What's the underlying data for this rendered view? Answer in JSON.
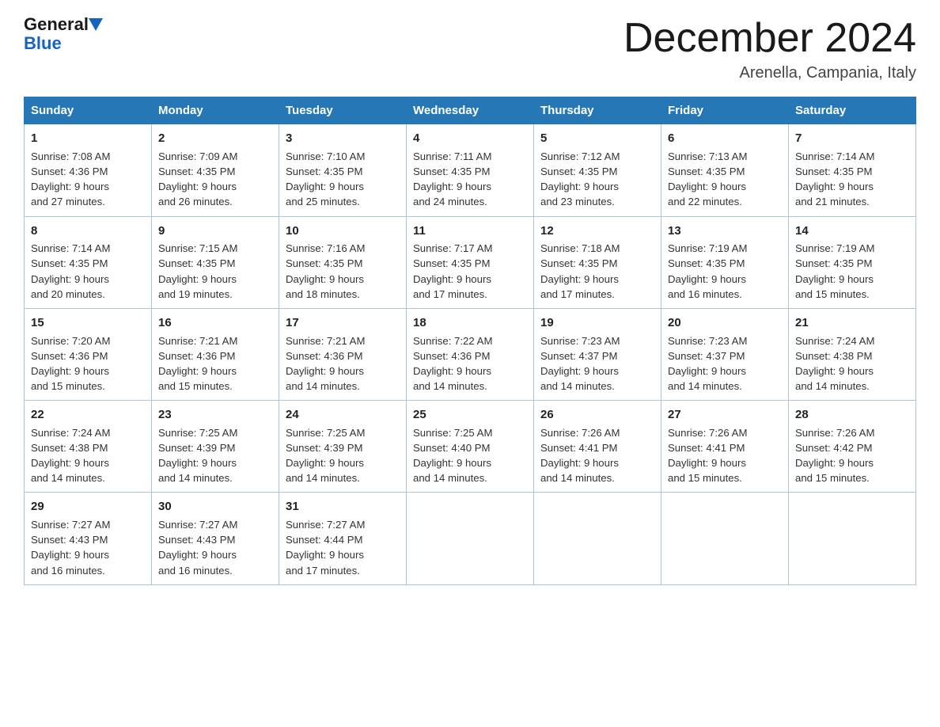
{
  "header": {
    "logo_general": "General",
    "logo_blue": "Blue",
    "month_title": "December 2024",
    "location": "Arenella, Campania, Italy"
  },
  "days_of_week": [
    "Sunday",
    "Monday",
    "Tuesday",
    "Wednesday",
    "Thursday",
    "Friday",
    "Saturday"
  ],
  "weeks": [
    [
      {
        "day": "1",
        "sunrise": "7:08 AM",
        "sunset": "4:36 PM",
        "daylight": "9 hours and 27 minutes."
      },
      {
        "day": "2",
        "sunrise": "7:09 AM",
        "sunset": "4:35 PM",
        "daylight": "9 hours and 26 minutes."
      },
      {
        "day": "3",
        "sunrise": "7:10 AM",
        "sunset": "4:35 PM",
        "daylight": "9 hours and 25 minutes."
      },
      {
        "day": "4",
        "sunrise": "7:11 AM",
        "sunset": "4:35 PM",
        "daylight": "9 hours and 24 minutes."
      },
      {
        "day": "5",
        "sunrise": "7:12 AM",
        "sunset": "4:35 PM",
        "daylight": "9 hours and 23 minutes."
      },
      {
        "day": "6",
        "sunrise": "7:13 AM",
        "sunset": "4:35 PM",
        "daylight": "9 hours and 22 minutes."
      },
      {
        "day": "7",
        "sunrise": "7:14 AM",
        "sunset": "4:35 PM",
        "daylight": "9 hours and 21 minutes."
      }
    ],
    [
      {
        "day": "8",
        "sunrise": "7:14 AM",
        "sunset": "4:35 PM",
        "daylight": "9 hours and 20 minutes."
      },
      {
        "day": "9",
        "sunrise": "7:15 AM",
        "sunset": "4:35 PM",
        "daylight": "9 hours and 19 minutes."
      },
      {
        "day": "10",
        "sunrise": "7:16 AM",
        "sunset": "4:35 PM",
        "daylight": "9 hours and 18 minutes."
      },
      {
        "day": "11",
        "sunrise": "7:17 AM",
        "sunset": "4:35 PM",
        "daylight": "9 hours and 17 minutes."
      },
      {
        "day": "12",
        "sunrise": "7:18 AM",
        "sunset": "4:35 PM",
        "daylight": "9 hours and 17 minutes."
      },
      {
        "day": "13",
        "sunrise": "7:19 AM",
        "sunset": "4:35 PM",
        "daylight": "9 hours and 16 minutes."
      },
      {
        "day": "14",
        "sunrise": "7:19 AM",
        "sunset": "4:35 PM",
        "daylight": "9 hours and 15 minutes."
      }
    ],
    [
      {
        "day": "15",
        "sunrise": "7:20 AM",
        "sunset": "4:36 PM",
        "daylight": "9 hours and 15 minutes."
      },
      {
        "day": "16",
        "sunrise": "7:21 AM",
        "sunset": "4:36 PM",
        "daylight": "9 hours and 15 minutes."
      },
      {
        "day": "17",
        "sunrise": "7:21 AM",
        "sunset": "4:36 PM",
        "daylight": "9 hours and 14 minutes."
      },
      {
        "day": "18",
        "sunrise": "7:22 AM",
        "sunset": "4:36 PM",
        "daylight": "9 hours and 14 minutes."
      },
      {
        "day": "19",
        "sunrise": "7:23 AM",
        "sunset": "4:37 PM",
        "daylight": "9 hours and 14 minutes."
      },
      {
        "day": "20",
        "sunrise": "7:23 AM",
        "sunset": "4:37 PM",
        "daylight": "9 hours and 14 minutes."
      },
      {
        "day": "21",
        "sunrise": "7:24 AM",
        "sunset": "4:38 PM",
        "daylight": "9 hours and 14 minutes."
      }
    ],
    [
      {
        "day": "22",
        "sunrise": "7:24 AM",
        "sunset": "4:38 PM",
        "daylight": "9 hours and 14 minutes."
      },
      {
        "day": "23",
        "sunrise": "7:25 AM",
        "sunset": "4:39 PM",
        "daylight": "9 hours and 14 minutes."
      },
      {
        "day": "24",
        "sunrise": "7:25 AM",
        "sunset": "4:39 PM",
        "daylight": "9 hours and 14 minutes."
      },
      {
        "day": "25",
        "sunrise": "7:25 AM",
        "sunset": "4:40 PM",
        "daylight": "9 hours and 14 minutes."
      },
      {
        "day": "26",
        "sunrise": "7:26 AM",
        "sunset": "4:41 PM",
        "daylight": "9 hours and 14 minutes."
      },
      {
        "day": "27",
        "sunrise": "7:26 AM",
        "sunset": "4:41 PM",
        "daylight": "9 hours and 15 minutes."
      },
      {
        "day": "28",
        "sunrise": "7:26 AM",
        "sunset": "4:42 PM",
        "daylight": "9 hours and 15 minutes."
      }
    ],
    [
      {
        "day": "29",
        "sunrise": "7:27 AM",
        "sunset": "4:43 PM",
        "daylight": "9 hours and 16 minutes."
      },
      {
        "day": "30",
        "sunrise": "7:27 AM",
        "sunset": "4:43 PM",
        "daylight": "9 hours and 16 minutes."
      },
      {
        "day": "31",
        "sunrise": "7:27 AM",
        "sunset": "4:44 PM",
        "daylight": "9 hours and 17 minutes."
      },
      null,
      null,
      null,
      null
    ]
  ],
  "labels": {
    "sunrise": "Sunrise:",
    "sunset": "Sunset:",
    "daylight": "Daylight:"
  }
}
